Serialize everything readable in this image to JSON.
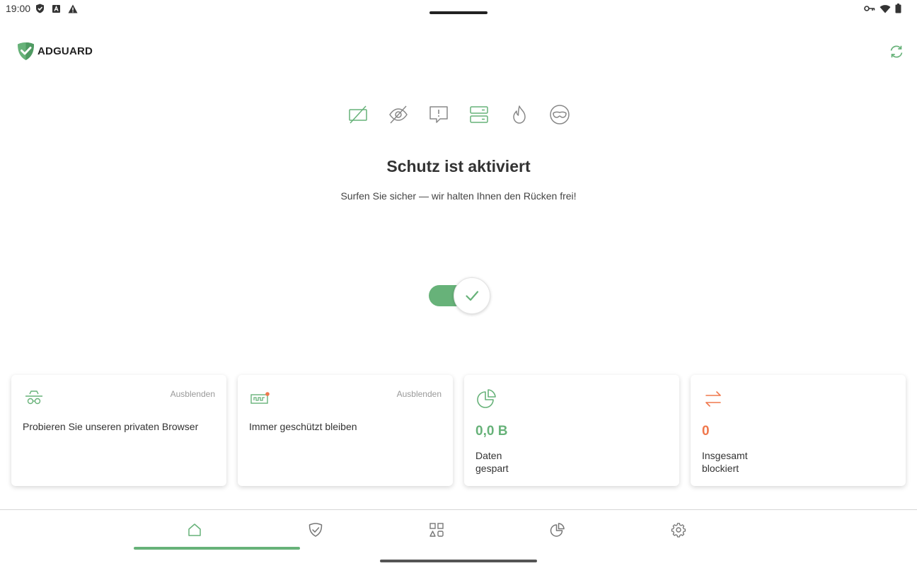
{
  "status_bar": {
    "time": "19:00",
    "left_icons": [
      "shield-check-icon",
      "font-a-icon",
      "warning-icon"
    ],
    "right_icons": [
      "vpn-key-icon",
      "wifi-icon",
      "battery-icon"
    ]
  },
  "header": {
    "logo_text": "ADGUARD",
    "refresh_icon": "refresh-icon"
  },
  "features": [
    {
      "icon": "ad-blocking-icon",
      "color": "#67b279"
    },
    {
      "icon": "tracking-protection-icon",
      "color": "#888888"
    },
    {
      "icon": "annoyances-icon",
      "color": "#888888"
    },
    {
      "icon": "dns-protection-icon",
      "color": "#67b279"
    },
    {
      "icon": "firewall-icon",
      "color": "#888888"
    },
    {
      "icon": "stealth-mode-icon",
      "color": "#888888"
    }
  ],
  "main": {
    "title": "Schutz ist aktiviert",
    "subtitle": "Surfen Sie sicher — wir halten Ihnen den Rücken frei!",
    "toggle_on": true
  },
  "cards": [
    {
      "icon": "incognito-icon",
      "hide_label": "Ausblenden",
      "text": "Probieren Sie unseren privaten Browser"
    },
    {
      "icon": "license-ticket-icon",
      "hide_label": "Ausblenden",
      "text": "Immer geschützt bleiben"
    },
    {
      "icon": "pie-chart-icon",
      "value": "0,0 B",
      "label_line1": "Daten",
      "label_line2": "gespart",
      "value_color": "#67b279"
    },
    {
      "icon": "transfer-arrows-icon",
      "value": "0",
      "label_line1": "Insgesamt",
      "label_line2": "blockiert",
      "value_color": "#f0784d"
    }
  ],
  "nav": {
    "items": [
      {
        "id": "home",
        "icon": "home-icon",
        "active": true
      },
      {
        "id": "protection",
        "icon": "shield-check-icon",
        "active": false
      },
      {
        "id": "apps",
        "icon": "apps-shapes-icon",
        "active": false
      },
      {
        "id": "statistics",
        "icon": "statistics-pie-icon",
        "active": false
      },
      {
        "id": "settings",
        "icon": "settings-gear-icon",
        "active": false
      }
    ]
  },
  "colors": {
    "accent_green": "#67b279",
    "accent_orange": "#f0784d",
    "icon_gray": "#888888"
  }
}
